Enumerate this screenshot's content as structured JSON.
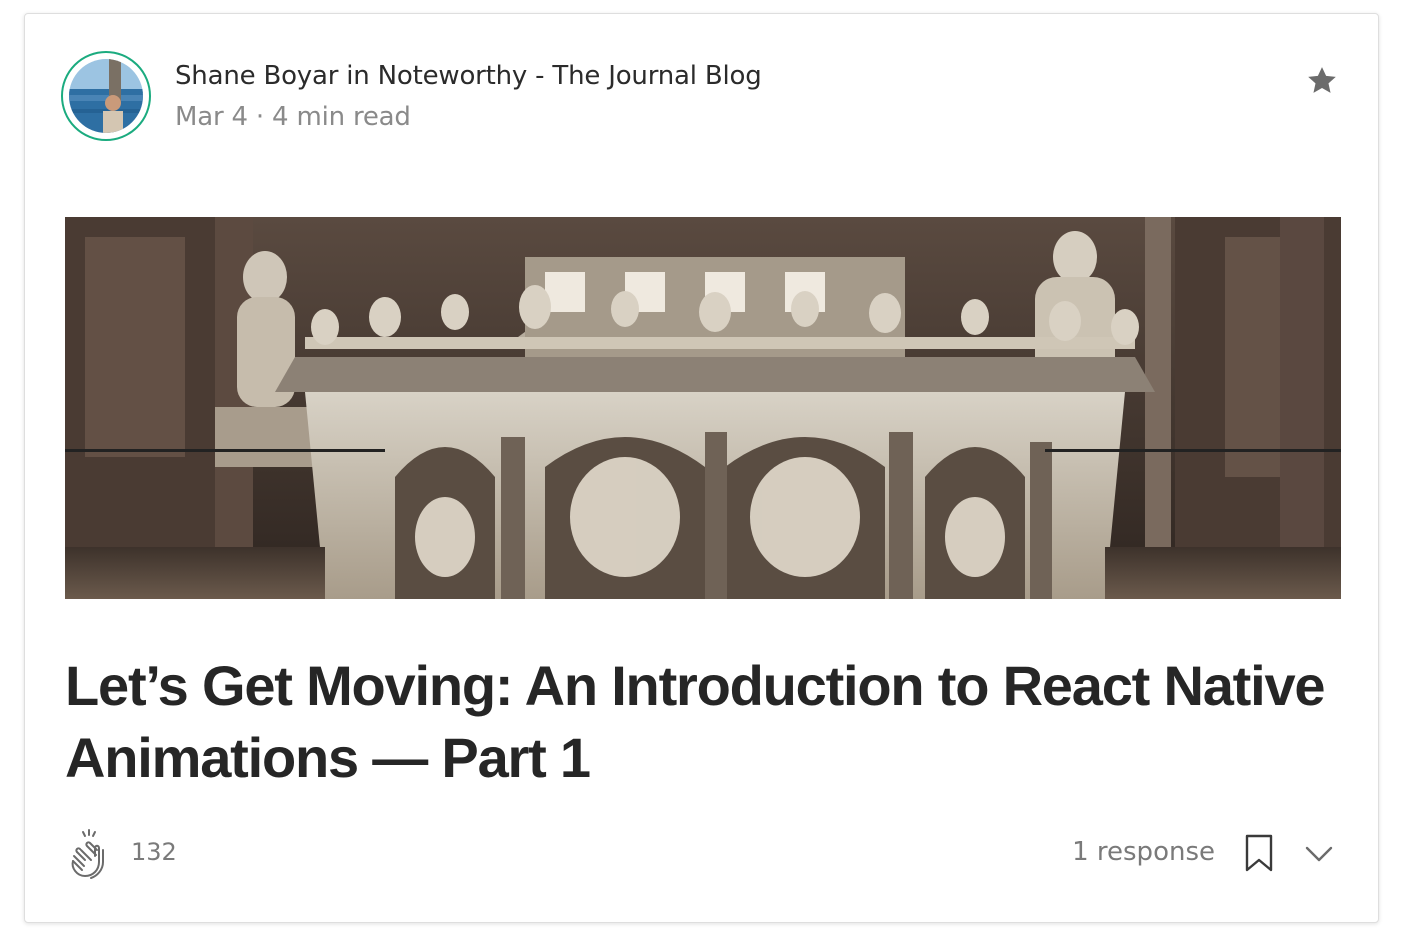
{
  "post": {
    "author_line": "Shane Boyar in Noteworthy - The Journal Blog",
    "meta_line": "Mar 4 · 4 min read",
    "title": "Let’s Get Moving: An Introduction to React Native Animations — Part 1"
  },
  "footer": {
    "clap_count": "132",
    "responses": "1 response"
  },
  "icons": {
    "star": "star-icon",
    "clap": "clap-icon",
    "bookmark": "bookmark-icon",
    "chevron": "chevron-down-icon"
  },
  "colors": {
    "avatar_ring": "#1bab7f",
    "title": "#262626",
    "muted": "#8a8a8a"
  }
}
